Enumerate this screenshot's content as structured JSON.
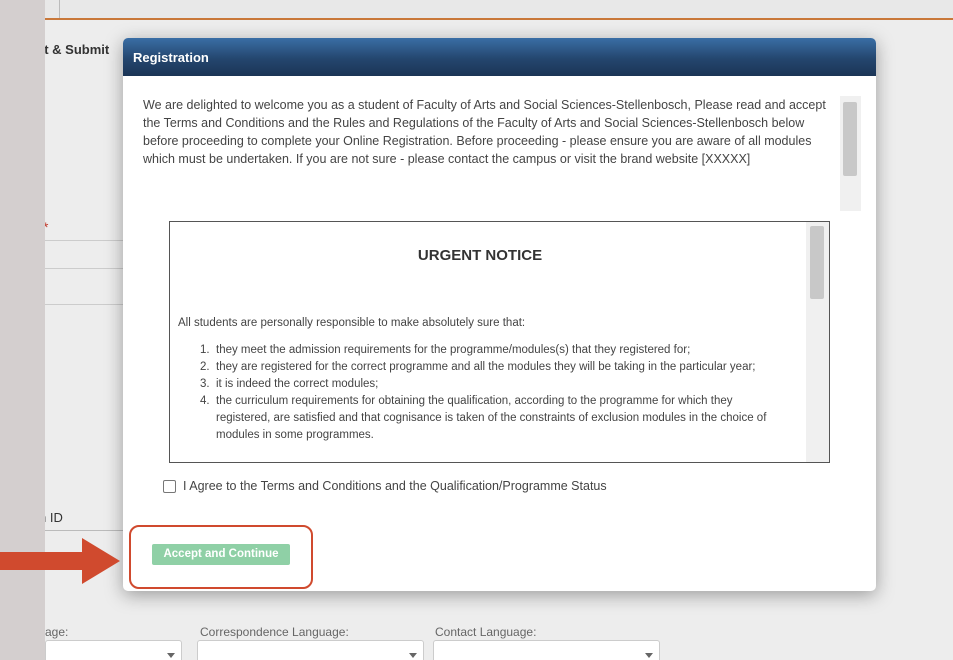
{
  "background": {
    "step_label": "xt & Submit",
    "field_label": "n ID",
    "required_mark": "*",
    "language_labels": [
      "age:",
      "Correspondence Language:",
      "Contact Language:"
    ]
  },
  "modal": {
    "title": "Registration",
    "intro": "We are delighted to welcome you as a student of Faculty of Arts and Social Sciences-Stellenbosch, Please read and accept the Terms and Conditions and the Rules and Regulations of the Faculty of Arts and Social Sciences-Stellenbosch below before proceeding to complete your Online Registration. Before proceeding - please ensure you are aware of all modules which must be undertaken. If you are not sure - please contact the campus or visit the brand website [XXXXX]",
    "notice": {
      "title": "URGENT NOTICE",
      "lead": "All students are personally responsible to make absolutely sure that:",
      "items": [
        "they meet the admission requirements for the programme/modules(s) that they registered for;",
        "they are registered for the correct programme and all the modules they will be taking in the particular year;",
        "it is indeed the correct modules;",
        "the curriculum requirements for obtaining the qualification, according to the programme for which they registered, are satisfied and that cognisance is taken of the constraints of exclusion modules in the choice of modules in some programmes."
      ]
    },
    "agree_label": "I Agree to the Terms and Conditions and the Qualification/Programme Status",
    "accept_button": "Accept and Continue"
  },
  "annotation": {
    "color": "#d04a2e"
  }
}
